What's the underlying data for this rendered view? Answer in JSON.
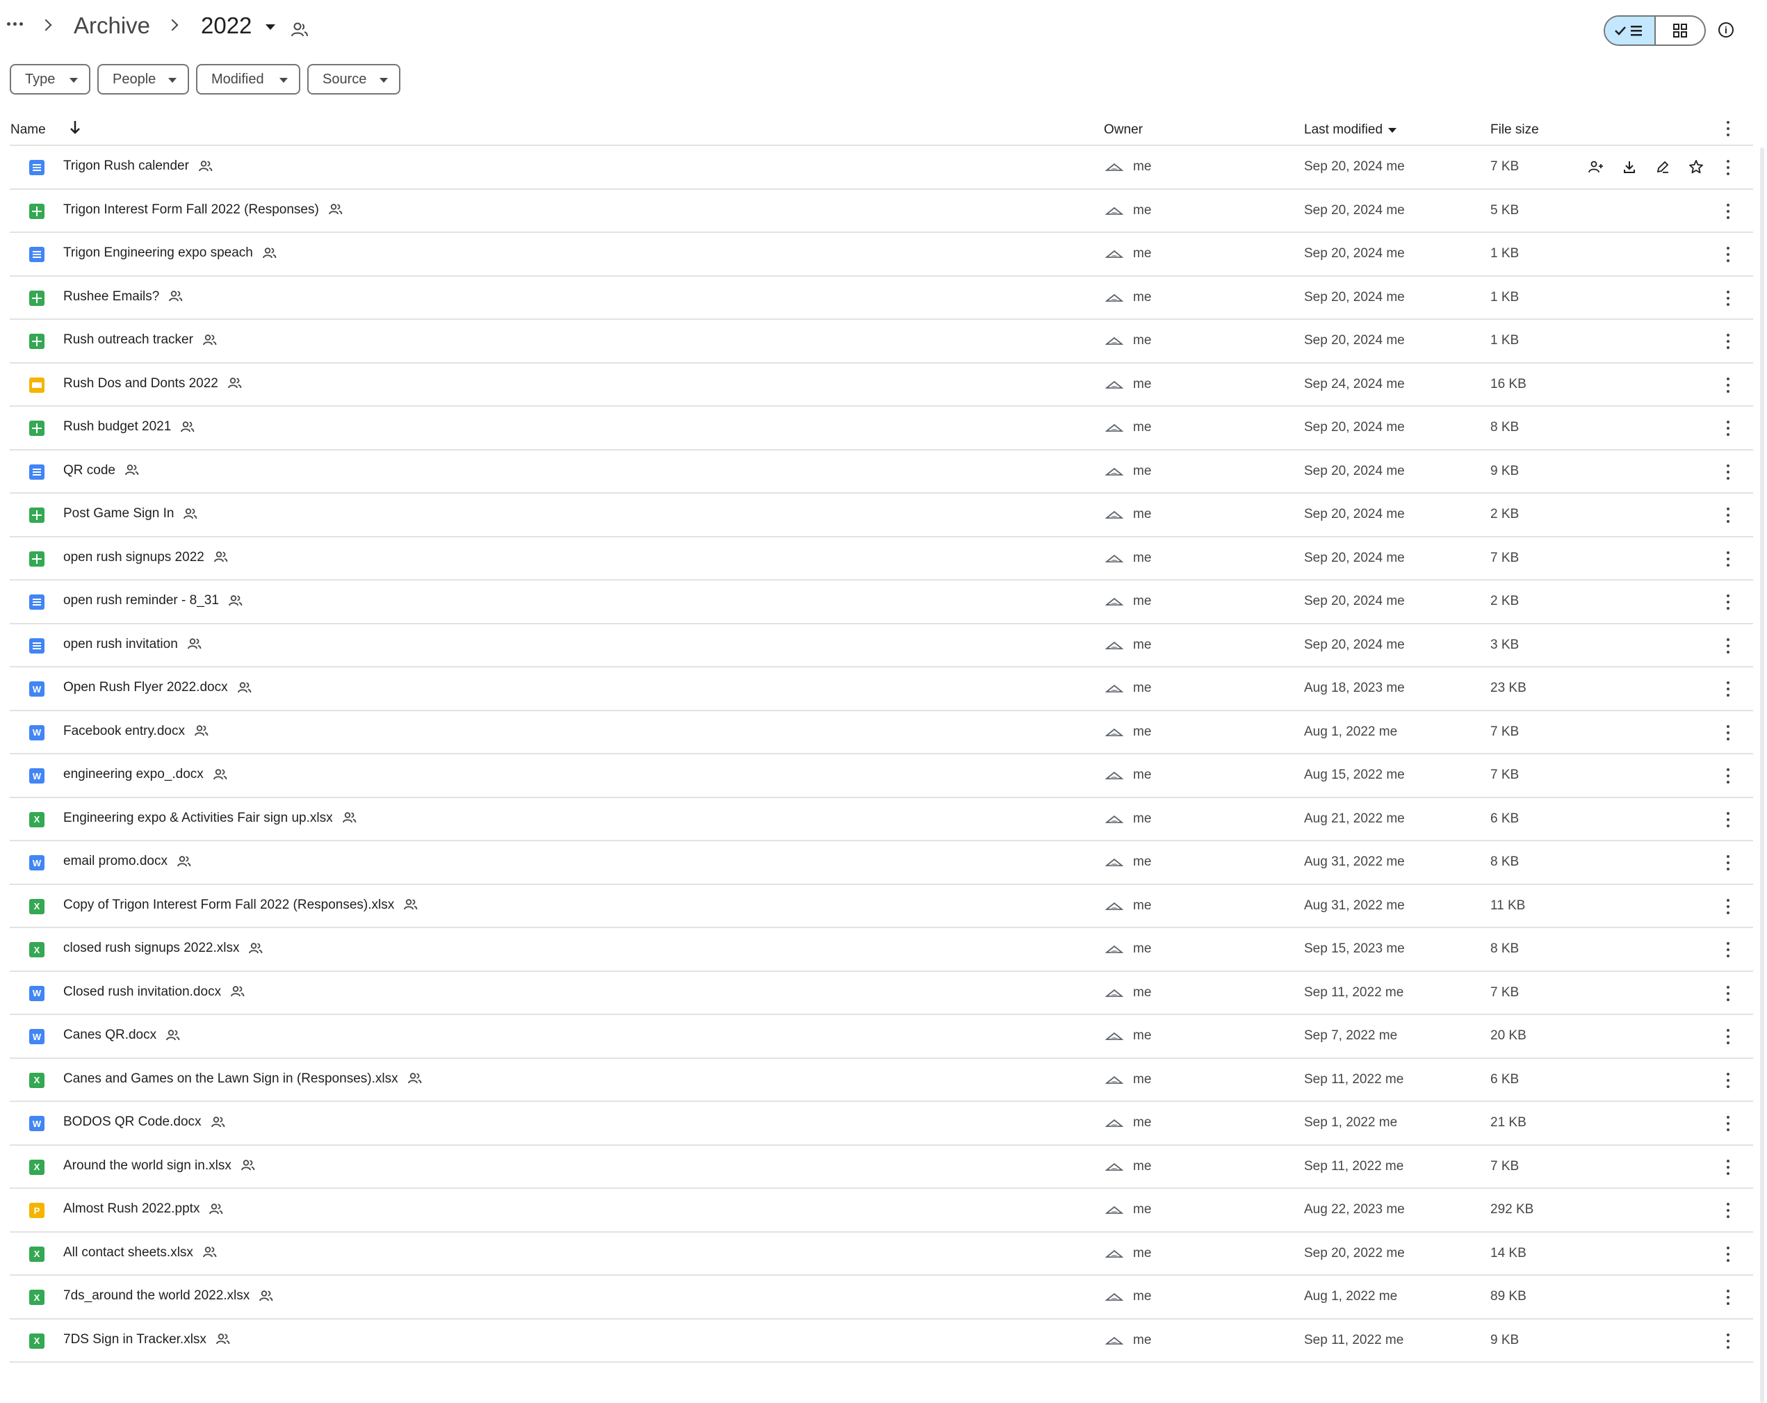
{
  "breadcrumb": {
    "parent": "Archive",
    "current": "2022"
  },
  "filters": [
    "Type",
    "People",
    "Modified",
    "Source"
  ],
  "columns": {
    "name": "Name",
    "owner": "Owner",
    "modified": "Last modified",
    "size": "File size"
  },
  "files": [
    {
      "name": "Trigon Rush calender",
      "type": "doc",
      "owner": "me",
      "modified": "Sep 20, 2024 me",
      "size": "7 KB"
    },
    {
      "name": "Trigon Interest Form Fall 2022 (Responses)",
      "type": "sheet",
      "owner": "me",
      "modified": "Sep 20, 2024 me",
      "size": "5 KB"
    },
    {
      "name": "Trigon Engineering expo speach",
      "type": "doc",
      "owner": "me",
      "modified": "Sep 20, 2024 me",
      "size": "1 KB"
    },
    {
      "name": "Rushee Emails?",
      "type": "sheet",
      "owner": "me",
      "modified": "Sep 20, 2024 me",
      "size": "1 KB"
    },
    {
      "name": "Rush outreach tracker",
      "type": "sheet",
      "owner": "me",
      "modified": "Sep 20, 2024 me",
      "size": "1 KB"
    },
    {
      "name": "Rush Dos and Donts 2022",
      "type": "slide",
      "owner": "me",
      "modified": "Sep 24, 2024 me",
      "size": "16 KB"
    },
    {
      "name": "Rush budget 2021",
      "type": "sheet",
      "owner": "me",
      "modified": "Sep 20, 2024 me",
      "size": "8 KB"
    },
    {
      "name": "QR code",
      "type": "doc",
      "owner": "me",
      "modified": "Sep 20, 2024 me",
      "size": "9 KB"
    },
    {
      "name": "Post Game Sign In",
      "type": "sheet",
      "owner": "me",
      "modified": "Sep 20, 2024 me",
      "size": "2 KB"
    },
    {
      "name": "open rush signups 2022",
      "type": "sheet",
      "owner": "me",
      "modified": "Sep 20, 2024 me",
      "size": "7 KB"
    },
    {
      "name": "open rush reminder - 8_31",
      "type": "doc",
      "owner": "me",
      "modified": "Sep 20, 2024 me",
      "size": "2 KB"
    },
    {
      "name": "open rush invitation",
      "type": "doc",
      "owner": "me",
      "modified": "Sep 20, 2024 me",
      "size": "3 KB"
    },
    {
      "name": "Open Rush Flyer 2022.docx",
      "type": "word",
      "owner": "me",
      "modified": "Aug 18, 2023 me",
      "size": "23 KB"
    },
    {
      "name": "Facebook entry.docx",
      "type": "word",
      "owner": "me",
      "modified": "Aug 1, 2022 me",
      "size": "7 KB"
    },
    {
      "name": "engineering expo_.docx",
      "type": "word",
      "owner": "me",
      "modified": "Aug 15, 2022 me",
      "size": "7 KB"
    },
    {
      "name": "Engineering expo & Activities Fair sign up.xlsx",
      "type": "excel",
      "owner": "me",
      "modified": "Aug 21, 2022 me",
      "size": "6 KB"
    },
    {
      "name": "email promo.docx",
      "type": "word",
      "owner": "me",
      "modified": "Aug 31, 2022 me",
      "size": "8 KB"
    },
    {
      "name": "Copy of Trigon Interest Form Fall 2022 (Responses).xlsx",
      "type": "excel",
      "owner": "me",
      "modified": "Aug 31, 2022 me",
      "size": "11 KB"
    },
    {
      "name": "closed rush signups 2022.xlsx",
      "type": "excel",
      "owner": "me",
      "modified": "Sep 15, 2023 me",
      "size": "8 KB"
    },
    {
      "name": "Closed rush invitation.docx",
      "type": "word",
      "owner": "me",
      "modified": "Sep 11, 2022 me",
      "size": "7 KB"
    },
    {
      "name": "Canes QR.docx",
      "type": "word",
      "owner": "me",
      "modified": "Sep 7, 2022 me",
      "size": "20 KB"
    },
    {
      "name": "Canes and Games on the Lawn Sign in  (Responses).xlsx",
      "type": "excel",
      "owner": "me",
      "modified": "Sep 11, 2022 me",
      "size": "6 KB"
    },
    {
      "name": "BODOS QR Code.docx",
      "type": "word",
      "owner": "me",
      "modified": "Sep 1, 2022 me",
      "size": "21 KB"
    },
    {
      "name": "Around the world sign in.xlsx",
      "type": "excel",
      "owner": "me",
      "modified": "Sep 11, 2022 me",
      "size": "7 KB"
    },
    {
      "name": "Almost Rush 2022.pptx",
      "type": "ppt",
      "owner": "me",
      "modified": "Aug 22, 2023 me",
      "size": "292 KB"
    },
    {
      "name": "All contact sheets.xlsx",
      "type": "excel",
      "owner": "me",
      "modified": "Sep 20, 2022 me",
      "size": "14 KB"
    },
    {
      "name": "7ds_around the world 2022.xlsx",
      "type": "excel",
      "owner": "me",
      "modified": "Aug 1, 2022 me",
      "size": "89 KB"
    },
    {
      "name": "7DS Sign in Tracker.xlsx",
      "type": "excel",
      "owner": "me",
      "modified": "Sep 11, 2022 me",
      "size": "9 KB"
    }
  ],
  "icons": {
    "doc": "google-docs-icon",
    "sheet": "google-sheets-icon",
    "slide": "google-slides-icon",
    "word": "word-docx-icon",
    "excel": "excel-xlsx-icon",
    "ppt": "powerpoint-pptx-icon",
    "word_letter": "W",
    "excel_letter": "X",
    "ppt_letter": "P"
  },
  "colors": {
    "doc": "#4285f4",
    "sheet": "#34a853",
    "slide": "#f4b400",
    "view_toggle_active": "#c2e7ff"
  }
}
